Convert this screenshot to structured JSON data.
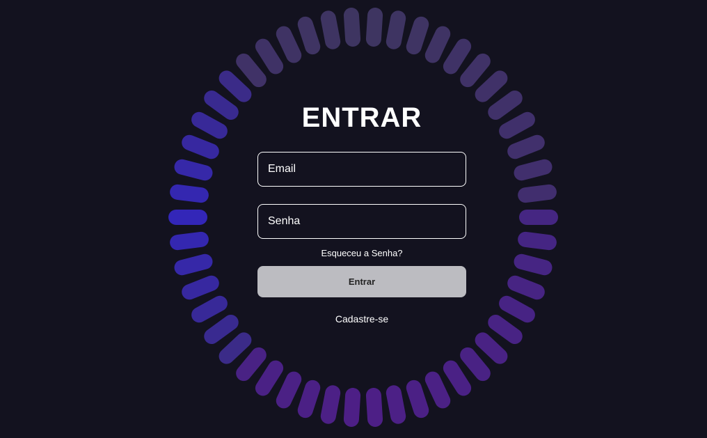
{
  "login": {
    "title": "ENTRAR",
    "email_placeholder": "Email",
    "password_placeholder": "Senha",
    "forgot_label": "Esqueceu a Senha?",
    "submit_label": "Entrar",
    "signup_label": "Cadastre-se"
  },
  "theme": {
    "background": "#13121f",
    "ring_color_default": "#3d2a6b",
    "ring_color_active": "#3326b8",
    "button_bg": "#bcbcc1"
  }
}
